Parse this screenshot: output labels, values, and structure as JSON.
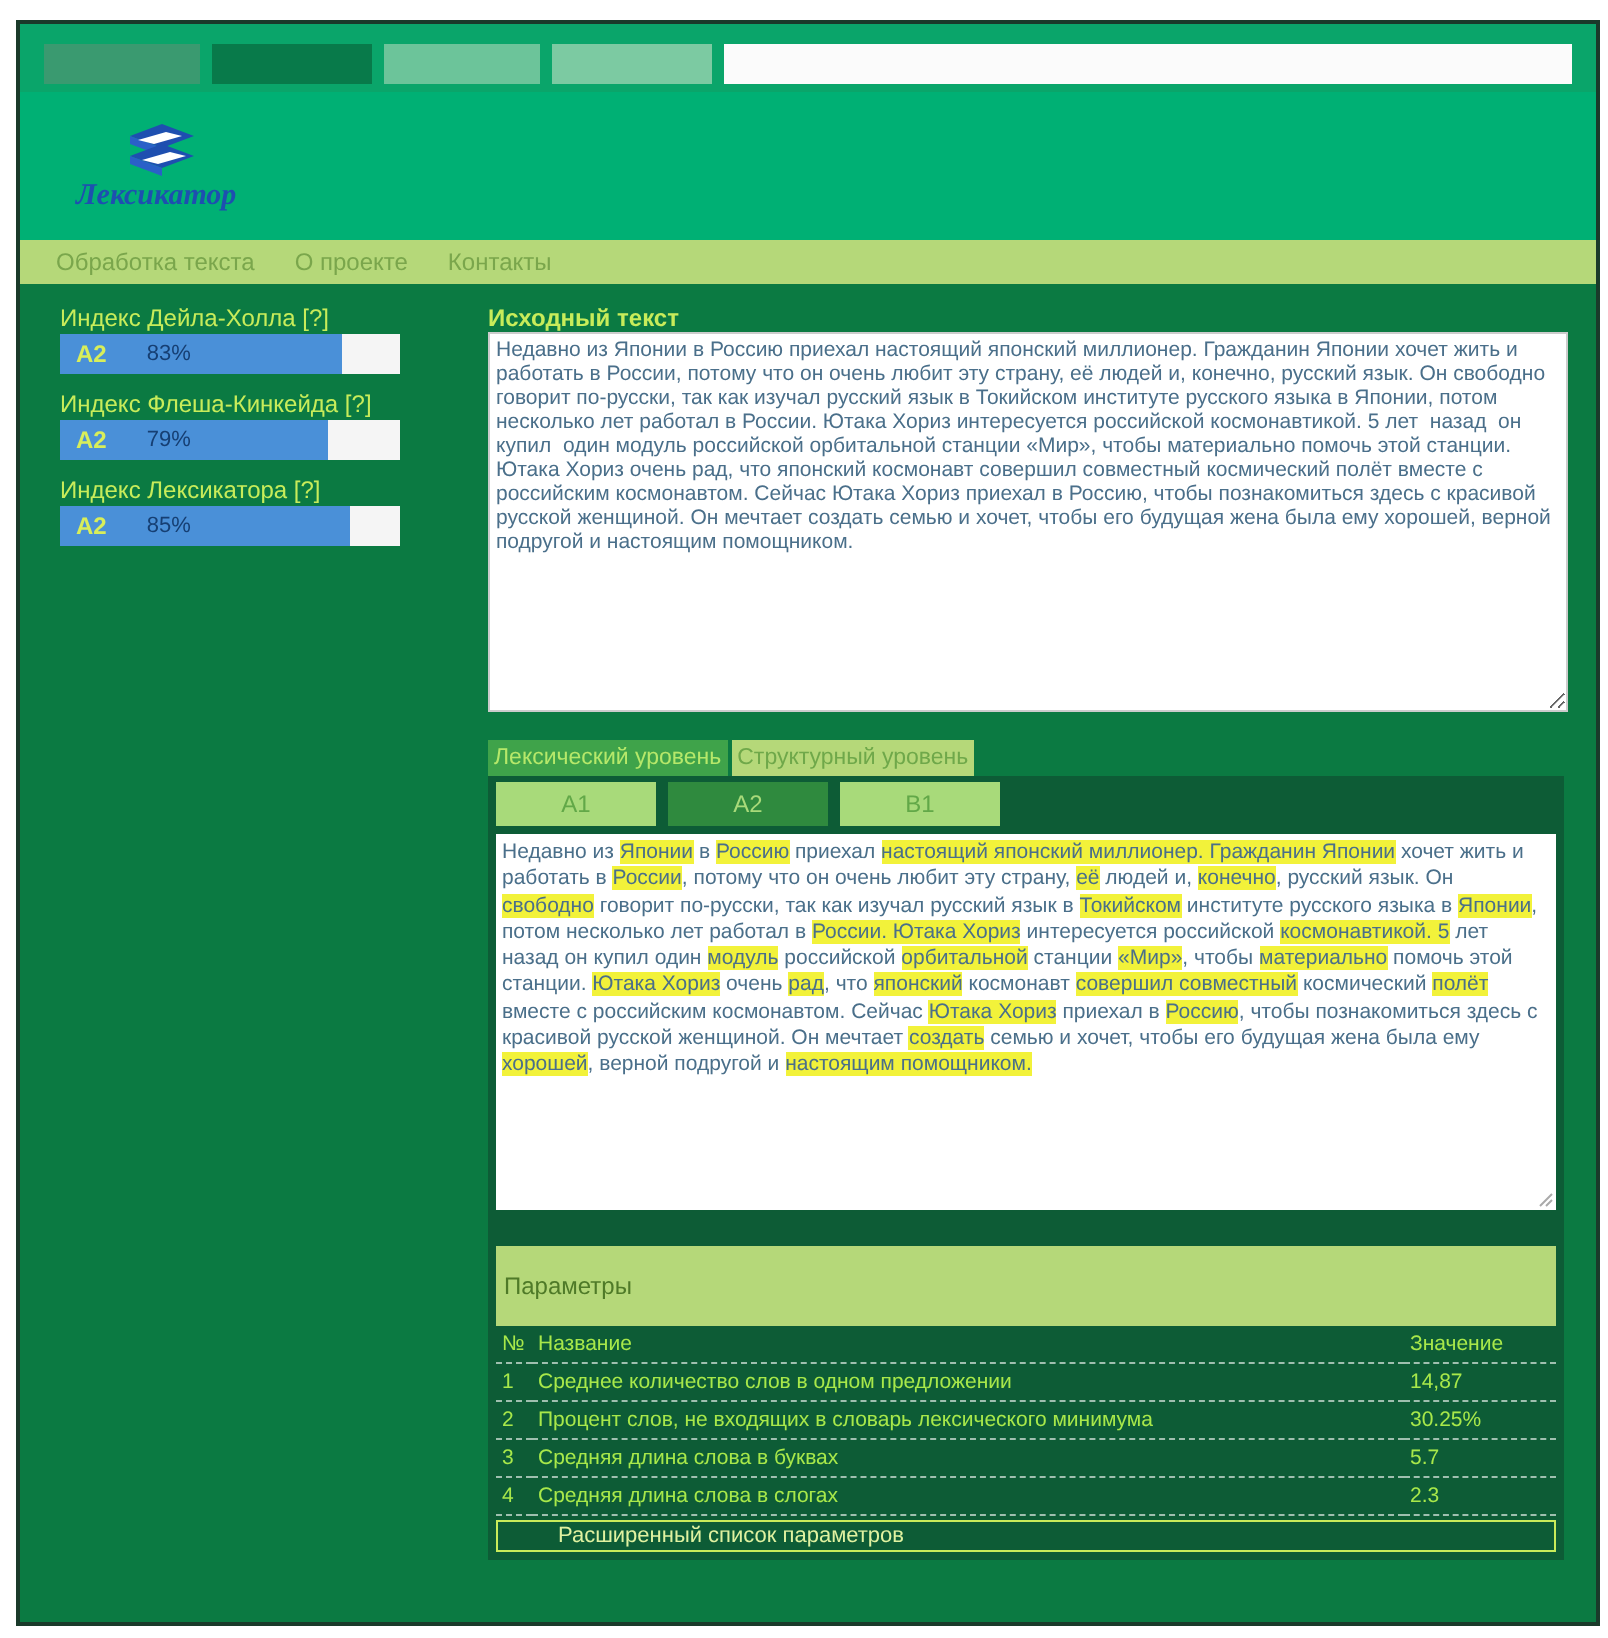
{
  "logo": {
    "text": "Лексикатор"
  },
  "nav": [
    {
      "label": "Обработка текста"
    },
    {
      "label": "О проекте"
    },
    {
      "label": "Контакты"
    }
  ],
  "indices": [
    {
      "label": "Индекс Дейла-Холла [?]",
      "grade": "A2",
      "percent": "83%",
      "level": 0.83
    },
    {
      "label": "Индекс Флеша-Кинкейда [?]",
      "grade": "A2",
      "percent": "79%",
      "level": 0.79
    },
    {
      "label": "Индекс Лексикатора [?]",
      "grade": "A2",
      "percent": "85%",
      "level": 0.85
    }
  ],
  "source": {
    "title": "Исходный текст",
    "value": "Недавно из Японии в Россию приехал настоящий японский миллионер. Гражданин Японии хочет жить и работать в России, потому что он очень любит эту страну, её людей и, конечно, русский язык. Он свободно говорит по-русски, так как изучал русский язык в Токийском институте русского языка в Японии, потом несколько лет работал в России. Ютака Хориз интересуется российской космонавтикой. 5 лет  назад  он  купил  один модуль российской орбитальной станции «Мир», чтобы материально помочь этой станции. Ютака Хориз очень рад, что японский космонавт совершил совместный космический полёт вместе с российским космонавтом. Сейчас Ютака Хориз приехал в Россию, чтобы познакомиться здесь с красивой русской женщиной. Он мечтает создать семью и хочет, чтобы его будущая жена была ему хорошей, верной подругой и настоящим помощником."
  },
  "analysis_tabs": [
    {
      "label": "Лексический уровень",
      "selected": true
    },
    {
      "label": "Структурный уровень",
      "selected": false
    }
  ],
  "level_tabs": [
    {
      "label": "A1",
      "selected": false
    },
    {
      "label": "A2",
      "selected": true
    },
    {
      "label": "B1",
      "selected": false
    }
  ],
  "segments": [
    {
      "text": "Недавно из ",
      "highlight": false
    },
    {
      "text": "Японии",
      "highlight": true
    },
    {
      "text": " в ",
      "highlight": false
    },
    {
      "text": "Россию",
      "highlight": true
    },
    {
      "text": " приехал ",
      "highlight": false
    },
    {
      "text": "настоящий японский миллионер. Гражданин Японии",
      "highlight": true
    },
    {
      "text": " хочет жить и работать в ",
      "highlight": false
    },
    {
      "text": "России",
      "highlight": true
    },
    {
      "text": ", потому что он очень любит эту страну, ",
      "highlight": false
    },
    {
      "text": "её",
      "highlight": true
    },
    {
      "text": " людей и, ",
      "highlight": false
    },
    {
      "text": "конечно",
      "highlight": true
    },
    {
      "text": ", русский язык. Он ",
      "highlight": false
    },
    {
      "text": "свободно",
      "highlight": true
    },
    {
      "text": " говорит по-русски, так как изучал русский язык в ",
      "highlight": false
    },
    {
      "text": "Токийском",
      "highlight": true
    },
    {
      "text": " институте русского языка в ",
      "highlight": false
    },
    {
      "text": "Японии",
      "highlight": true
    },
    {
      "text": ", потом несколько лет работал в ",
      "highlight": false
    },
    {
      "text": "России. Ютака Хориз",
      "highlight": true
    },
    {
      "text": " интересуется российской ",
      "highlight": false
    },
    {
      "text": "космонавтикой. ",
      "highlight": true
    },
    {
      "text": "5",
      "highlight": true
    },
    {
      "text": " лет  назад  он  купил  один  ",
      "highlight": false
    },
    {
      "text": "модуль",
      "highlight": true
    },
    {
      "text": " российской ",
      "highlight": false
    },
    {
      "text": "орбитальной",
      "highlight": true
    },
    {
      "text": " станции ",
      "highlight": false
    },
    {
      "text": "«Мир»",
      "highlight": true
    },
    {
      "text": ", чтобы ",
      "highlight": false
    },
    {
      "text": "материально",
      "highlight": true
    },
    {
      "text": " помочь этой станции. ",
      "highlight": false
    },
    {
      "text": "Ютака Хориз",
      "highlight": true
    },
    {
      "text": " очень ",
      "highlight": false
    },
    {
      "text": "рад",
      "highlight": true
    },
    {
      "text": ", что ",
      "highlight": false
    },
    {
      "text": "японский",
      "highlight": true
    },
    {
      "text": " космонавт ",
      "highlight": false
    },
    {
      "text": "совершил совместный",
      "highlight": true
    },
    {
      "text": " космический ",
      "highlight": false
    },
    {
      "text": "полёт",
      "highlight": true
    },
    {
      "text": " вместе с российским космонавтом. Сейчас ",
      "highlight": false
    },
    {
      "text": "Ютака Хориз",
      "highlight": true
    },
    {
      "text": " приехал в ",
      "highlight": false
    },
    {
      "text": "Россию",
      "highlight": true
    },
    {
      "text": ", чтобы познакомиться здесь с красивой русской женщиной. Он мечтает ",
      "highlight": false
    },
    {
      "text": "создать",
      "highlight": true
    },
    {
      "text": " семью и хочет, чтобы его будущая жена была ему ",
      "highlight": false
    },
    {
      "text": "хорошей",
      "highlight": true
    },
    {
      "text": ", верной подругой и ",
      "highlight": false
    },
    {
      "text": "настоящим помощником.",
      "highlight": true
    }
  ],
  "params": {
    "title": "Параметры",
    "columns": [
      "№",
      "Название",
      "Значение"
    ],
    "rows": [
      [
        "1",
        "Среднее количество слов в одном предложении",
        "14,87"
      ],
      [
        "2",
        "Процент слов, не входящих в словарь лексического минимума",
        "30.25%"
      ],
      [
        "3",
        "Средняя длина слова в буквах",
        "5.7"
      ],
      [
        "4",
        "Средняя длина слова в слогах",
        "2.3"
      ]
    ],
    "expand_button": "Расширенный список параметров"
  }
}
